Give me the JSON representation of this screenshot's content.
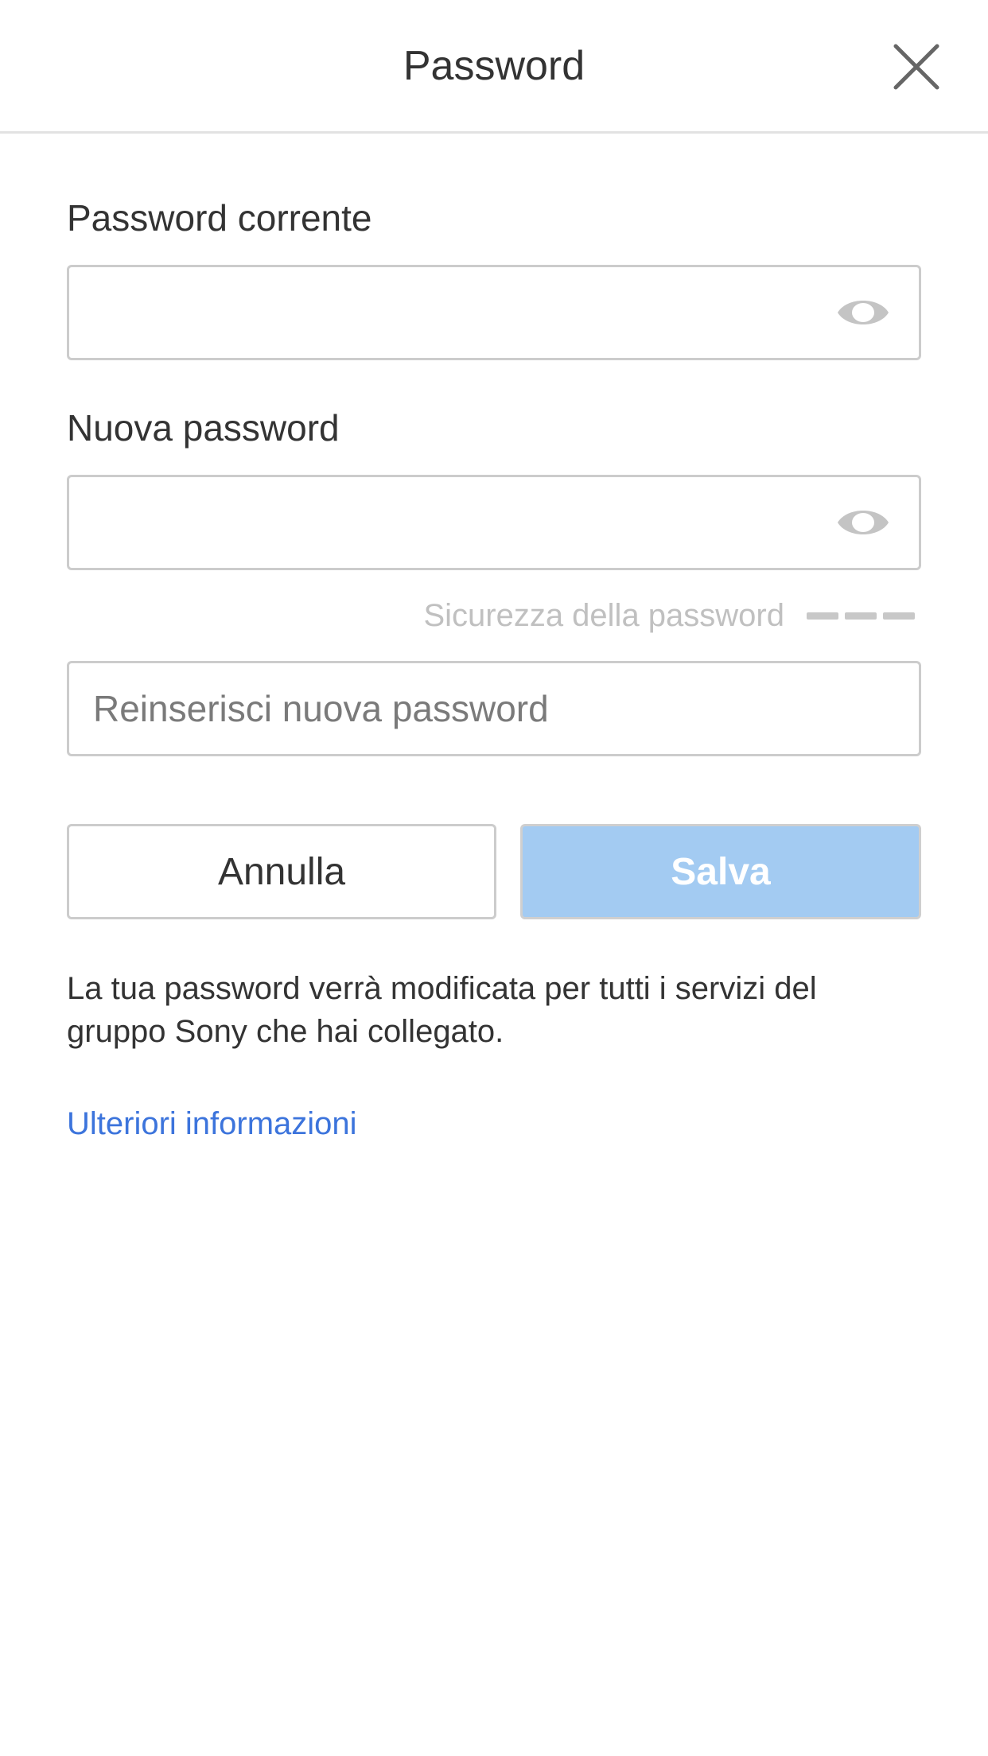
{
  "header": {
    "title": "Password",
    "close_icon": "close-icon"
  },
  "current_password": {
    "label": "Password corrente",
    "value": "",
    "placeholder": "",
    "toggle_icon": "eye-icon"
  },
  "new_password": {
    "label": "Nuova password",
    "value": "",
    "placeholder": "",
    "toggle_icon": "eye-icon"
  },
  "strength": {
    "label": "Sicurezza della password",
    "filled_segments": 0,
    "total_segments": 3
  },
  "confirm_password": {
    "value": "",
    "placeholder": "Reinserisci nuova password"
  },
  "actions": {
    "cancel_label": "Annulla",
    "save_label": "Salva",
    "save_enabled": false
  },
  "info_text": "La tua password verrà modificata per tutti i servizi del gruppo Sony che hai collegato.",
  "more_info_link": "Ulteriori informazioni",
  "colors": {
    "accent_link": "#3c74dc",
    "save_disabled": "#a3cbf2",
    "text": "#333333"
  }
}
